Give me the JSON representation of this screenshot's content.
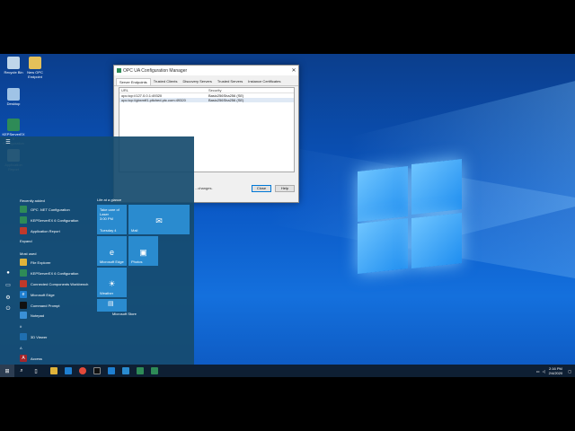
{
  "desktop": {
    "icons": [
      {
        "label": "Recycle Bin",
        "icon": "recycle-bin-icon"
      },
      {
        "label": "New OPC Endpoint",
        "icon": "folder-icon"
      },
      {
        "label": "Desktop",
        "icon": "desktop-icon"
      },
      {
        "label": "KEPServerEX 6 Configuration",
        "icon": "kepserver-icon"
      },
      {
        "label": "Application Report",
        "icon": "app-report-icon"
      }
    ]
  },
  "dialog": {
    "title": "OPC UA Configuration Manager",
    "tabs": [
      "Server Endpoints",
      "Trusted Clients",
      "Discovery Servers",
      "Trusted Servers",
      "Instance Certificates"
    ],
    "columns": [
      "URL",
      "Security"
    ],
    "rows": [
      {
        "url": "opc.tcp://127.0.0.1:49320",
        "security": "Basic256Sha256 (SE)"
      },
      {
        "url": "opc.tcp://gbxmtf1.pitched.ptc.com:49320",
        "security": "Basic256Sha256 (SE)"
      }
    ],
    "status": "...changes.",
    "close_label": "Close",
    "help_label": "Help"
  },
  "start_menu": {
    "recently_added_label": "Recently added",
    "recent": [
      {
        "label": "OPC .NET Configuration",
        "icon": "opc-net-icon",
        "color": "#2e8b57"
      },
      {
        "label": "KEPServerEX 6 Configuration",
        "icon": "kepserver-icon",
        "color": "#2e8b57"
      },
      {
        "label": "Application Report",
        "icon": "app-report-icon",
        "color": "#c0392b"
      }
    ],
    "expand_label": "Expand",
    "most_used_label": "Most used",
    "most_used": [
      {
        "label": "File Explorer",
        "icon": "folder-icon",
        "color": "#e0b33a"
      },
      {
        "label": "KEPServerEX 6 Configuration",
        "icon": "kepserver-icon",
        "color": "#2e8b57"
      },
      {
        "label": "Connected Components Workbench",
        "icon": "ccw-icon",
        "color": "#c0392b"
      },
      {
        "label": "Microsoft Edge",
        "icon": "edge-icon",
        "color": "#1f7fd0"
      },
      {
        "label": "Command Prompt",
        "icon": "cmd-icon",
        "color": "#111111"
      },
      {
        "label": "Notepad",
        "icon": "notepad-icon",
        "color": "#3a8fd6"
      }
    ],
    "letter_hash": "#",
    "hash_apps": [
      {
        "label": "3D Viewer",
        "icon": "3d-viewer-icon",
        "color": "#1f6fb0"
      }
    ],
    "letter_a": "A",
    "a_apps": [
      {
        "label": "Access",
        "icon": "access-icon",
        "color": "#a4262c"
      }
    ],
    "tiles_heading": "Life at a glance",
    "tiles": {
      "calendar_text": "Take care of Laser",
      "calendar_time": "3:00 PM",
      "calendar_day": "Tuesday 4",
      "mail": "Mail",
      "edge": "Microsoft Edge",
      "photos": "Photos",
      "weather": "Weather",
      "store": "Microsoft Store"
    }
  },
  "taskbar": {
    "time": "2:16 PM",
    "date": "2/4/2020"
  }
}
